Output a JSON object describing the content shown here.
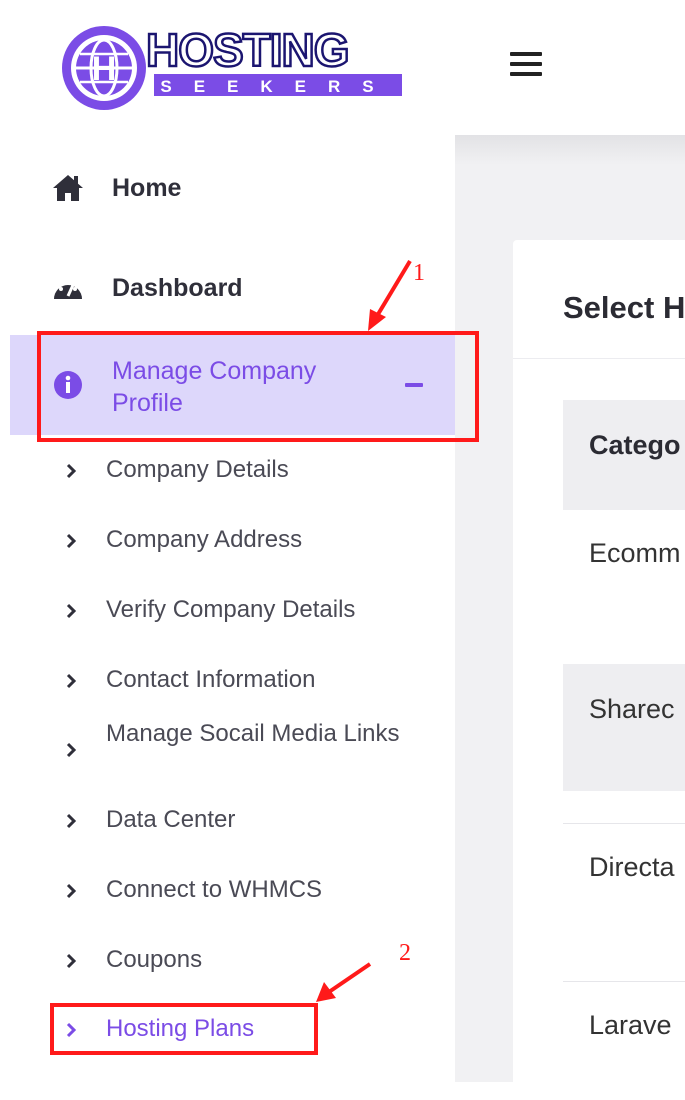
{
  "brand": {
    "logo_text_main": "HOSTING",
    "logo_text_sub": "SEEKERS",
    "accent_color": "#7b4ce6"
  },
  "sidebar": {
    "items": [
      {
        "label": "Home",
        "icon": "home-icon"
      },
      {
        "label": "Dashboard",
        "icon": "dashboard-gauge-icon"
      },
      {
        "label": "Manage Company Profile",
        "icon": "info-circle-icon",
        "expanded": true
      }
    ],
    "submenu": [
      {
        "label": "Company Details"
      },
      {
        "label": "Company Address"
      },
      {
        "label": "Verify Company Details"
      },
      {
        "label": "Contact Information"
      },
      {
        "label": "Manage Socail Media Links"
      },
      {
        "label": "Data Center"
      },
      {
        "label": "Connect to WHMCS"
      },
      {
        "label": "Coupons"
      },
      {
        "label": "Hosting Plans",
        "active": true
      }
    ]
  },
  "annotations": {
    "step1": "1",
    "step2": "2",
    "color": "#ff1a1a"
  },
  "header": {
    "menu_icon": "hamburger-menu-icon"
  },
  "main": {
    "card_title": "Select H",
    "table_header": "Catego",
    "rows": [
      "Ecomm",
      "Sharec",
      "Directa",
      "Larave"
    ]
  }
}
